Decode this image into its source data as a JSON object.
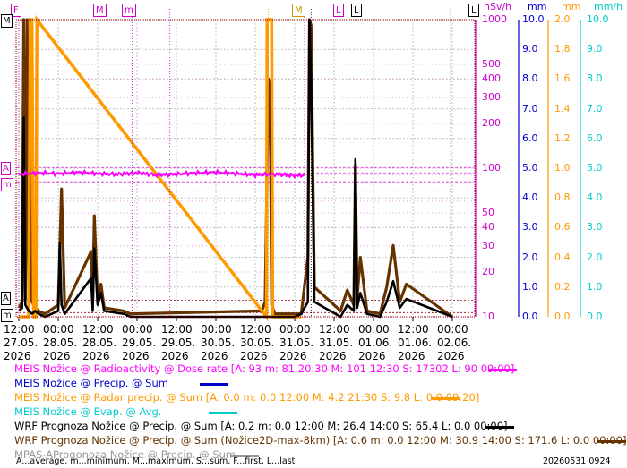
{
  "colors": {
    "radio": "#ff00ff",
    "precip_meis": "#0000cc",
    "radar": "#ff9900",
    "evap": "#00cccc",
    "wrf": "#000000",
    "wrf_max": "#663300",
    "mpas": "#999999",
    "grid": "#c0c0c0",
    "frame_dot": "#990000"
  },
  "axes": {
    "left_markers": [
      "M",
      "A",
      "m",
      "A",
      "m"
    ],
    "top_markers": [
      "F",
      "M",
      "m",
      "M",
      "L",
      "L",
      "L"
    ],
    "log_axis": {
      "unit": "nSv/h",
      "ticks": [
        "1000",
        "500",
        "400",
        "300",
        "200",
        "100",
        "50",
        "40",
        "30",
        "20",
        "10"
      ]
    },
    "blue_axis": {
      "unit": "mm",
      "ticks": [
        "10.0",
        "9.0",
        "8.0",
        "7.0",
        "6.0",
        "5.0",
        "4.0",
        "3.0",
        "2.0",
        "1.0",
        "0.0"
      ]
    },
    "orange_axis": {
      "unit": "mm",
      "ticks": [
        "2.0",
        "1.8",
        "1.6",
        "1.4",
        "1.2",
        "1.0",
        "0.8",
        "0.6",
        "0.4",
        "0.2",
        "0.0"
      ]
    },
    "teal_axis": {
      "unit": "mm/h",
      "ticks": [
        "10.0",
        "9.0",
        "8.0",
        "7.0",
        "6.0",
        "5.0",
        "4.0",
        "3.0",
        "2.0",
        "1.0",
        "0.0"
      ]
    },
    "x_ticks": [
      {
        "time": "12:00",
        "date": "27.05.",
        "year": "2026"
      },
      {
        "time": "00:00",
        "date": "28.05.",
        "year": "2026"
      },
      {
        "time": "12:00",
        "date": "28.05.",
        "year": "2026"
      },
      {
        "time": "00:00",
        "date": "29.05.",
        "year": "2026"
      },
      {
        "time": "12:00",
        "date": "29.05.",
        "year": "2026"
      },
      {
        "time": "00:00",
        "date": "30.05.",
        "year": "2026"
      },
      {
        "time": "12:00",
        "date": "30.05.",
        "year": "2026"
      },
      {
        "time": "00:00",
        "date": "31.05.",
        "year": "2026"
      },
      {
        "time": "12:00",
        "date": "31.05.",
        "year": "2026"
      },
      {
        "time": "00:00",
        "date": "01.06.",
        "year": "2026"
      },
      {
        "time": "12:00",
        "date": "01.06.",
        "year": "2026"
      },
      {
        "time": "00:00",
        "date": "02.06.",
        "year": "2026"
      }
    ]
  },
  "legend": [
    {
      "key": "radio",
      "text": "MEIS Nožice @ Radioactivity @ Dose rate [A: 93 m: 81 20:30 M: 101 12:30 S: 17302 L: 90 09:00]"
    },
    {
      "key": "precip_meis",
      "text": "MEIS Nožice @ Precip. @ Sum"
    },
    {
      "key": "radar",
      "text": "MEIS Nožice @ Radar precip. @ Sum [A: 0.0 m: 0.0 12:00 M: 4.2 21:30 S: 9.8 L: 0.0 09:20]"
    },
    {
      "key": "evap",
      "text": "MEIS Nožice @ Evap. @ Avg."
    },
    {
      "key": "wrf",
      "text": "WRF Prognoza Nožice @ Precip. @ Sum [A: 0.2 m: 0.0 12:00 M: 26.4 14:00 S: 65.4 L: 0.0 00:00]"
    },
    {
      "key": "wrf_max",
      "text": "WRF Prognoza Nožice @ Precip. @ Sum (Nožice2D-max-8km) [A: 0.6 m: 0.0 12:00 M: 30.9 14:00 S: 171.6 L: 0.0 00:00]"
    },
    {
      "key": "mpas",
      "text": "MPAS-AProgonoza Nožice @ Precip. @ Sum"
    }
  ],
  "footer": {
    "abbrev": "A...average, m...minimum, M...maximum, S...sum, F...first, L...last",
    "stamp": "20260531 0924"
  },
  "chart_data": {
    "type": "line",
    "x_unit": "hours since 27.05.2026 12:00",
    "x_range": [
      0,
      132
    ],
    "series": [
      {
        "name": "MEIS Nožice @ Radioactivity @ Dose rate",
        "axis": "nSv/h (log)",
        "x": [
          0,
          6,
          12,
          18,
          24,
          30,
          36,
          42,
          48,
          54,
          60,
          66,
          72,
          78,
          84,
          87
        ],
        "values": [
          91,
          93,
          92,
          94,
          92,
          91,
          93,
          90,
          91,
          93,
          94,
          92,
          90,
          91,
          89,
          90
        ]
      },
      {
        "name": "MEIS Nožice @ Radar precip. @ Sum",
        "axis": "mm (0–2)",
        "x": [
          0,
          3,
          3.5,
          4,
          4.5,
          5.2,
          5.5,
          75.4,
          75.6,
          77,
          77.3,
          86
        ],
        "values": [
          0,
          0,
          2.0,
          2.0,
          0,
          0,
          2.0,
          0,
          2.0,
          2.0,
          0,
          0
        ]
      },
      {
        "name": "WRF Prognoza Nožice @ Precip. @ Sum",
        "axis": "mm (0–10)",
        "x": [
          0,
          1,
          1.5,
          2,
          3,
          4,
          5,
          6,
          8,
          12,
          12.5,
          13,
          14,
          22,
          22.5,
          23,
          24,
          25,
          26,
          32,
          34,
          84,
          86,
          88,
          88.5,
          89,
          90,
          98,
          100,
          102,
          102.5,
          103,
          104,
          106,
          110,
          112,
          114,
          116,
          118,
          132
        ],
        "values": [
          0.2,
          0.3,
          6.7,
          0.4,
          0.2,
          0.1,
          0.2,
          0.1,
          0,
          0.2,
          2.5,
          0.4,
          0.1,
          1.3,
          0.2,
          2.3,
          0.4,
          0.8,
          0.2,
          0.1,
          0,
          0,
          0.1,
          0.5,
          10.0,
          8.0,
          0.5,
          0,
          0.4,
          0.2,
          5.3,
          0.3,
          0.8,
          0.1,
          0,
          0.5,
          1.2,
          0.3,
          0.6,
          0
        ]
      },
      {
        "name": "WRF Prognoza Nožice @ Precip. @ Sum (Nožice2D-max-8km)",
        "axis": "mm (0–10)",
        "x": [
          0,
          1,
          1.5,
          2,
          2.5,
          3,
          3.5,
          4,
          5,
          6,
          8,
          12,
          13,
          14,
          22,
          22.5,
          23,
          24,
          25,
          26,
          32,
          34,
          74,
          75,
          76,
          76.5,
          77,
          78,
          86,
          88,
          88.5,
          89,
          90,
          98,
          100,
          102,
          102.5,
          103,
          104,
          106,
          110,
          112,
          114,
          116,
          118,
          132
        ],
        "values": [
          0.3,
          0.5,
          10.0,
          0.6,
          10.0,
          1.0,
          6.1,
          0.5,
          0.3,
          0.2,
          0.1,
          0.4,
          4.3,
          0.3,
          2.2,
          0.6,
          3.4,
          0.5,
          1.1,
          0.3,
          0.2,
          0.1,
          0.2,
          0.5,
          8.0,
          7.8,
          0.4,
          0.1,
          0.1,
          2.0,
          10.0,
          9.8,
          1.0,
          0.2,
          0.9,
          0.4,
          5.1,
          0.6,
          2.0,
          0.2,
          0.1,
          1.0,
          2.4,
          0.5,
          1.1,
          0
        ]
      }
    ]
  }
}
